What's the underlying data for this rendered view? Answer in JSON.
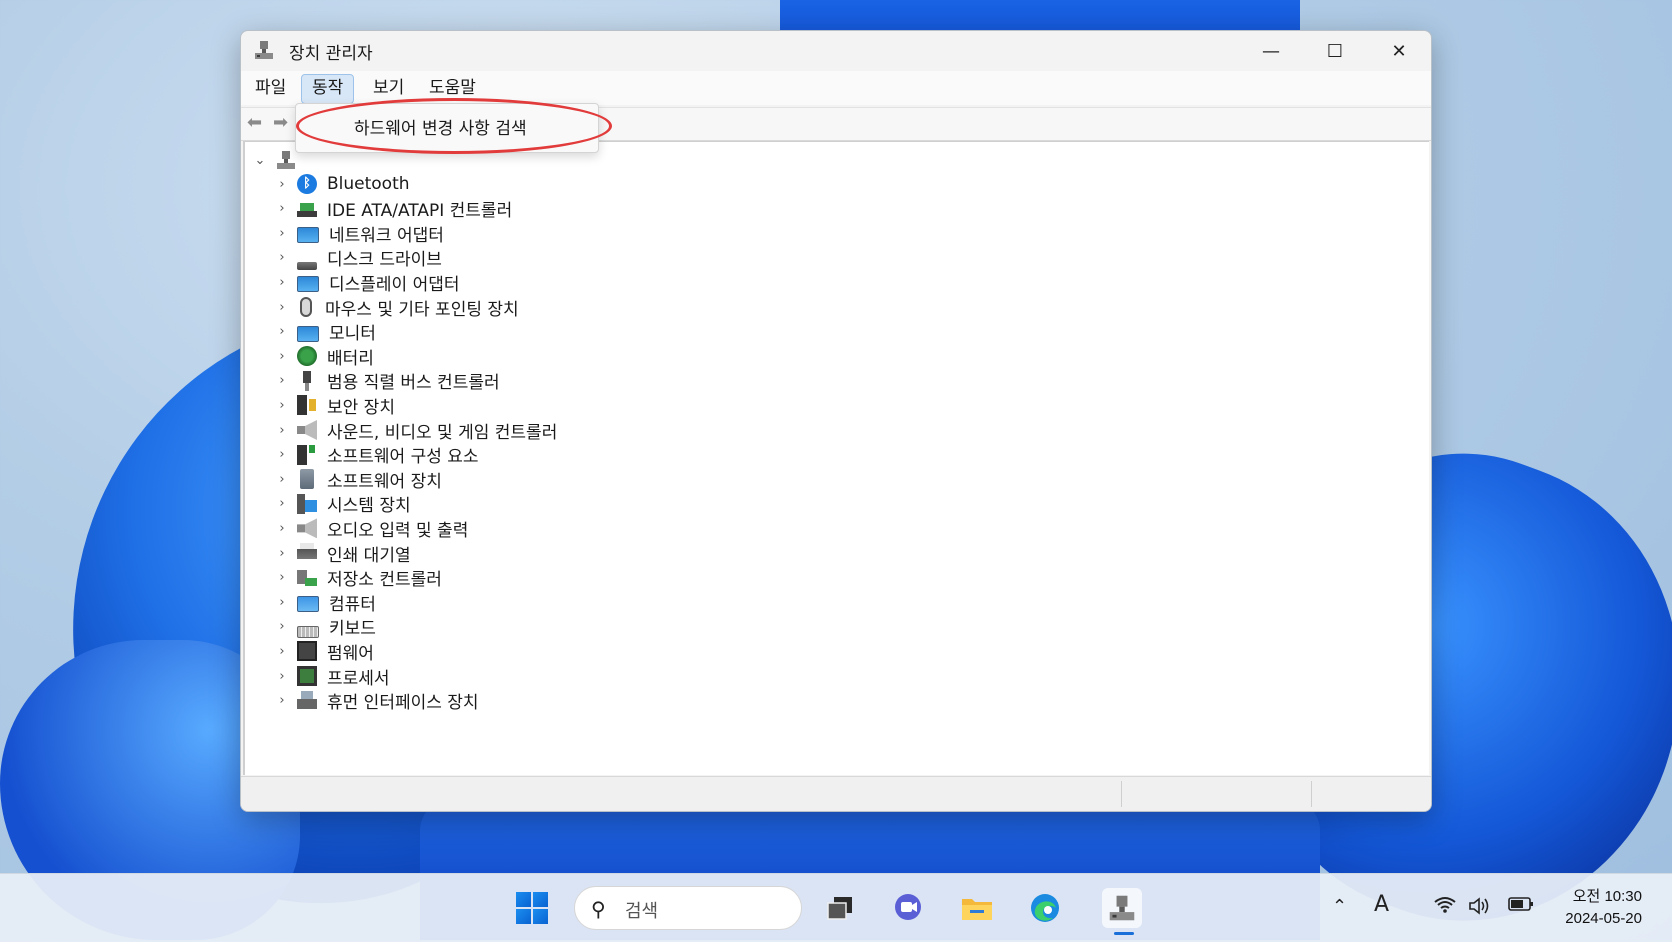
{
  "window": {
    "title": "장치 관리자",
    "minimize": "—",
    "maximize": "☐",
    "close": "✕"
  },
  "menu": {
    "items": [
      "파일",
      "동작",
      "보기",
      "도움말"
    ],
    "active_index": 1
  },
  "dropdown": {
    "item": "하드웨어 변경 사항 검색",
    "highlight_color": "#e23b3b"
  },
  "tree": {
    "items": [
      {
        "label": "Bluetooth",
        "icon": "bluetooth-icon"
      },
      {
        "label": "IDE ATA/ATAPI 컨트롤러",
        "icon": "controller-board-icon"
      },
      {
        "label": "네트워크 어댑터",
        "icon": "network-adapter-icon"
      },
      {
        "label": "디스크 드라이브",
        "icon": "disk-drive-icon"
      },
      {
        "label": "디스플레이 어댑터",
        "icon": "display-adapter-icon"
      },
      {
        "label": "마우스 및 기타 포인팅 장치",
        "icon": "mouse-icon"
      },
      {
        "label": "모니터",
        "icon": "monitor-icon"
      },
      {
        "label": "배터리",
        "icon": "battery-icon"
      },
      {
        "label": "범용 직렬 버스 컨트롤러",
        "icon": "usb-icon"
      },
      {
        "label": "보안 장치",
        "icon": "security-device-icon"
      },
      {
        "label": "사운드, 비디오 및 게임 컨트롤러",
        "icon": "speaker-icon"
      },
      {
        "label": "소프트웨어 구성 요소",
        "icon": "software-component-icon"
      },
      {
        "label": "소프트웨어 장치",
        "icon": "software-device-icon"
      },
      {
        "label": "시스템 장치",
        "icon": "system-device-icon"
      },
      {
        "label": "오디오 입력 및 출력",
        "icon": "audio-icon"
      },
      {
        "label": "인쇄 대기열",
        "icon": "printer-icon"
      },
      {
        "label": "저장소 컨트롤러",
        "icon": "storage-controller-icon"
      },
      {
        "label": "컴퓨터",
        "icon": "computer-icon"
      },
      {
        "label": "키보드",
        "icon": "keyboard-icon"
      },
      {
        "label": "펌웨어",
        "icon": "firmware-icon"
      },
      {
        "label": "프로세서",
        "icon": "processor-icon"
      },
      {
        "label": "휴먼 인터페이스 장치",
        "icon": "hid-icon"
      }
    ]
  },
  "taskbar": {
    "search_placeholder": "검색",
    "clock_time": "오전 10:30",
    "clock_date": "2024-05-20",
    "input_indicator": "A"
  }
}
